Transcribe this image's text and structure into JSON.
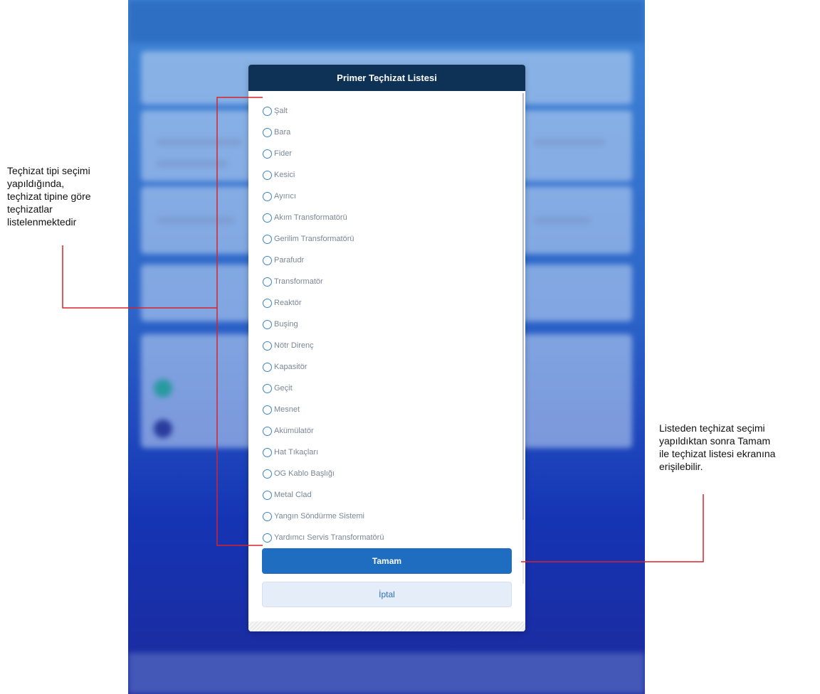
{
  "modal": {
    "title": "Primer Teçhizat Listesi",
    "items": [
      "Şalt",
      "Bara",
      "Fider",
      "Kesici",
      "Ayırıcı",
      "Akım Transformatörü",
      "Gerilim Transformatörü",
      "Parafudr",
      "Transformatör",
      "Reaktör",
      "Buşing",
      "Nötr Direnç",
      "Kapasitör",
      "Geçit",
      "Mesnet",
      "Akümülatör",
      "Hat Tıkaçları",
      "OG Kablo Başlığı",
      "Metal Clad",
      "Yangın Söndürme Sistemi",
      "Yardımcı Servis Transformatörü"
    ],
    "ok_label": "Tamam",
    "cancel_label": "İptal"
  },
  "annotations": {
    "left_note": "Teçhizat tipi seçimi\nyapıldığında,\nteçhizat tipine göre\nteçhizatlar\nlistelenmektedir",
    "right_note": "Listeden teçhizat seçimi\nyapıldıktan sonra Tamam\nile teçhizat listesi ekranına\nerişilebilir.",
    "line_color": "#d8232a"
  },
  "colors": {
    "header_bg": "#0e3156",
    "primary_button": "#1e6dc1",
    "radio_border": "#3b83c8"
  }
}
